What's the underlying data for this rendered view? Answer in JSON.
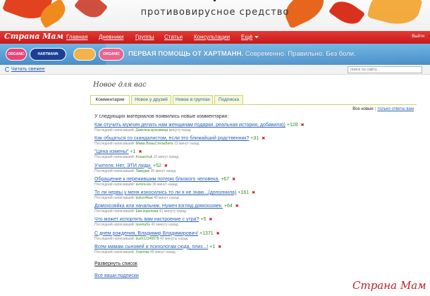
{
  "banner": {
    "text": "противовирусное средство",
    "top_mark": "•"
  },
  "nav": {
    "logo": "Страна Мам",
    "items": [
      "Главная",
      "Дневники",
      "Группы",
      "Статьи",
      "Консультации",
      "Ещё"
    ],
    "exit": "Выйти"
  },
  "ad": {
    "pills": [
      "ORGANIC",
      "HARTMANN",
      "",
      "ORGANIC"
    ],
    "slogan_bold": "ПЕРВАЯ ПОМОЩЬ ОТ ХАРТМАНН.",
    "slogan_rest": "Современно. Правильно. Без боли."
  },
  "toolbar": {
    "read_fresh": "Читать свежее",
    "search_placeholder": "поиск по сайту..."
  },
  "page_title": "Новое для вас",
  "tabs": [
    "Комментарии",
    "Новое у друзей",
    "Новое в группах",
    "Подписка"
  ],
  "filter": {
    "current": "Все новые",
    "separator": "|",
    "alt": "только ответы вам"
  },
  "intro": "У следующих материалов появились новые комментарии:",
  "meta_label": "Последний написавший:",
  "items": [
    {
      "title": "Как отучить мужчин делать нам женщинам подарки. реальная история, добавила))",
      "score": "+128",
      "user": "Дамочка-красавица",
      "time": "минуту назад"
    },
    {
      "title": "Как общаться со скандалистом, если это ближайший родственник?",
      "score": "+31",
      "user": "Мама ВовыСтепыВити",
      "time": "13 минут назад"
    },
    {
      "title": "\"Цена измены\"",
      "score": "+1",
      "user": "Kosarchuk",
      "time": "10 минут назад"
    },
    {
      "title": "Учителя. Нет, ЭТИ люди.",
      "score": "+52",
      "user": "Ламурик",
      "time": "35 минут назад"
    },
    {
      "title": "Обращение к пережившим потерю близкого человека.",
      "score": "+67",
      "user": "avrora-lav",
      "time": "36 минут назад"
    },
    {
      "title": "То ли нервы у меня износились то ли я не знаю...(дополнила)",
      "score": "+161",
      "user": "bukvo4kaa",
      "time": "40 минут назад"
    },
    {
      "title": "Домохозяйка или начальник. Нужен взгляд домохозяек.",
      "score": "+64",
      "user": "Ева-королева",
      "time": "41 минуту назад"
    },
    {
      "title": "Что может испортить вам настроение с утра?",
      "score": "+5",
      "user": "luvenaSv",
      "time": "41 минуту назад"
    },
    {
      "title": "С днем рождения, Владимир Владимирович!",
      "score": "+1371",
      "user": "buzh12345678",
      "time": "42 минуты назад"
    },
    {
      "title": "Всем мамам сыновей и психологам сюда, плиз...!",
      "score": "+1",
      "user": "Хорочка",
      "time": "45 минут назад"
    }
  ],
  "delete_mark": "✖",
  "expand": "Развернуть список",
  "all_subs": "Все ваши подписки",
  "watermark": "Страна Мам",
  "colors": {
    "nav_red": "#d5232a",
    "link_blue": "#2a62b0",
    "score_green": "#2f8e1d",
    "tab_border": "#cdd36e"
  }
}
